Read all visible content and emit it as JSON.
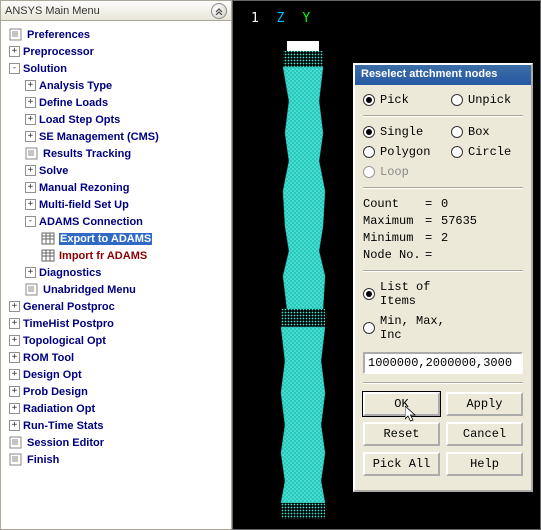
{
  "panel": {
    "title": "ANSYS Main Menu"
  },
  "tree": [
    {
      "depth": 0,
      "sym": "doc",
      "label": "Preferences"
    },
    {
      "depth": 0,
      "sym": "+",
      "label": "Preprocessor"
    },
    {
      "depth": 0,
      "sym": "-",
      "label": "Solution"
    },
    {
      "depth": 1,
      "sym": "+",
      "label": "Analysis Type"
    },
    {
      "depth": 1,
      "sym": "+",
      "label": "Define Loads"
    },
    {
      "depth": 1,
      "sym": "+",
      "label": "Load Step Opts"
    },
    {
      "depth": 1,
      "sym": "+",
      "label": "SE Management (CMS)"
    },
    {
      "depth": 1,
      "sym": "doc",
      "label": "Results Tracking"
    },
    {
      "depth": 1,
      "sym": "+",
      "label": "Solve"
    },
    {
      "depth": 1,
      "sym": "+",
      "label": "Manual Rezoning"
    },
    {
      "depth": 1,
      "sym": "+",
      "label": "Multi-field Set Up"
    },
    {
      "depth": 1,
      "sym": "-",
      "label": "ADAMS Connection"
    },
    {
      "depth": 2,
      "sym": "sheet",
      "label": "Export to ADAMS",
      "selected": true
    },
    {
      "depth": 2,
      "sym": "sheet",
      "label": "Import fr ADAMS",
      "brown": true
    },
    {
      "depth": 1,
      "sym": "+",
      "label": "Diagnostics"
    },
    {
      "depth": 1,
      "sym": "doc",
      "label": "Unabridged Menu"
    },
    {
      "depth": 0,
      "sym": "+",
      "label": "General Postproc"
    },
    {
      "depth": 0,
      "sym": "+",
      "label": "TimeHist Postpro"
    },
    {
      "depth": 0,
      "sym": "+",
      "label": "Topological Opt"
    },
    {
      "depth": 0,
      "sym": "+",
      "label": "ROM Tool"
    },
    {
      "depth": 0,
      "sym": "+",
      "label": "Design Opt"
    },
    {
      "depth": 0,
      "sym": "+",
      "label": "Prob Design"
    },
    {
      "depth": 0,
      "sym": "+",
      "label": "Radiation Opt"
    },
    {
      "depth": 0,
      "sym": "+",
      "label": "Run-Time Stats"
    },
    {
      "depth": 0,
      "sym": "doc",
      "label": "Session Editor"
    },
    {
      "depth": 0,
      "sym": "doc",
      "label": "Finish"
    }
  ],
  "axes": {
    "idx": "1",
    "z": "Z",
    "y": "Y"
  },
  "dialog": {
    "title": "Reselect attchment nodes",
    "pick": "Pick",
    "unpick": "Unpick",
    "single": "Single",
    "box": "Box",
    "polygon": "Polygon",
    "circle": "Circle",
    "loop": "Loop",
    "stats": {
      "count_label": "Count",
      "count_val": "0",
      "max_label": "Maximum",
      "max_val": "57635",
      "min_label": "Minimum",
      "min_val": "2",
      "node_label": "Node No.",
      "node_val": ""
    },
    "list_items": "List of Items",
    "min_max_inc": "Min, Max, Inc",
    "input_value": "1000000,2000000,3000",
    "buttons": {
      "ok": "OK",
      "apply": "Apply",
      "reset": "Reset",
      "cancel": "Cancel",
      "pick_all": "Pick All",
      "help": "Help"
    }
  }
}
